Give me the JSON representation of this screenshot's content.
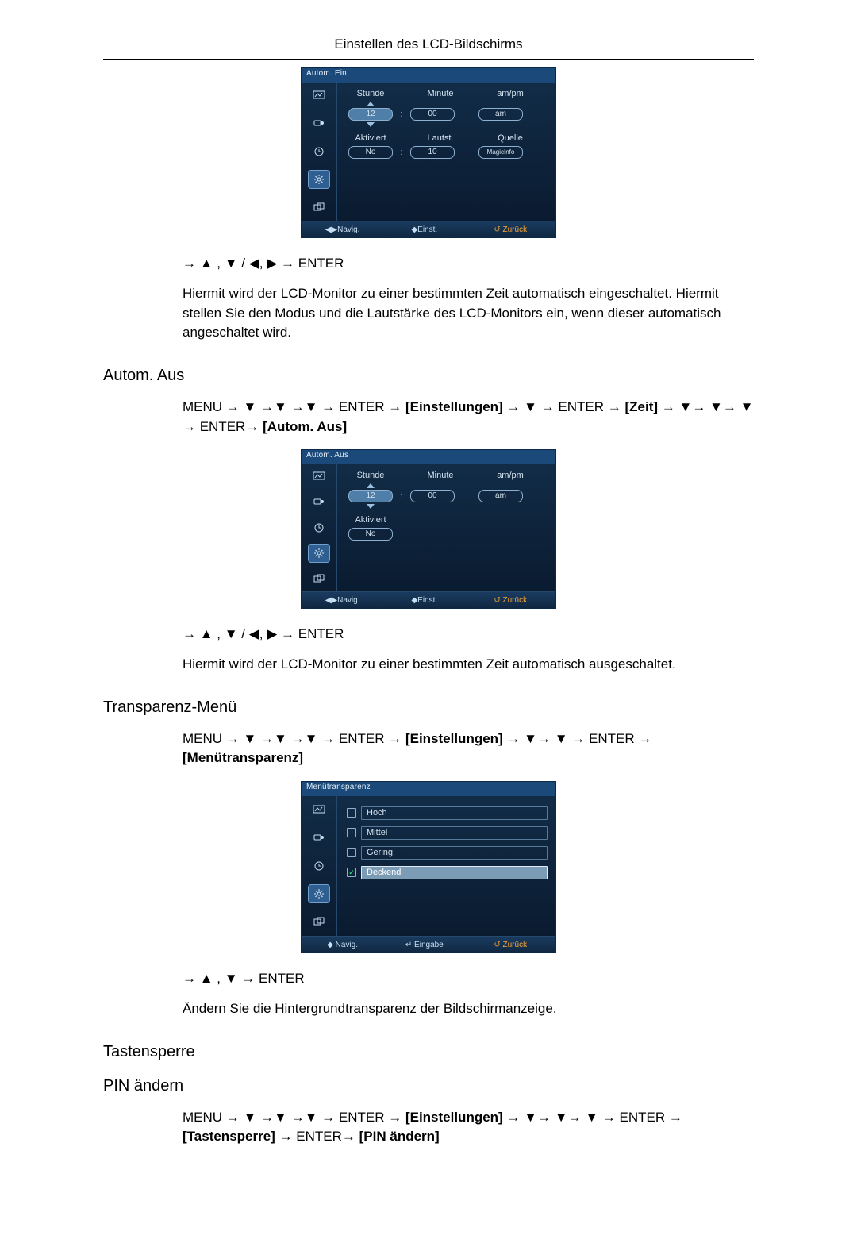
{
  "header": {
    "title": "Einstellen des LCD-Bildschirms"
  },
  "osd_on": {
    "title": "Autom. Ein",
    "labels": {
      "stunde": "Stunde",
      "minute": "Minute",
      "ampm": "am/pm",
      "aktiviert": "Aktiviert",
      "lautst": "Lautst.",
      "quelle": "Quelle"
    },
    "values": {
      "stunde": "12",
      "minute": "00",
      "ampm": "am",
      "aktiviert": "No",
      "lautst": "10",
      "quelle": "MagicInfo"
    },
    "footer": {
      "navig": "◀▶Navig.",
      "einst": "◆Einst.",
      "zurueck": "↺ Zurück"
    }
  },
  "nav_on_post": "→ ▲ , ▼ / ◀, ▶ → ENTER",
  "para_on": "Hiermit wird der LCD-Monitor zu einer bestimmten Zeit automatisch eingeschaltet. Hiermit stellen Sie den Modus und die Lautstärke des LCD-Monitors ein, wenn dieser automatisch angeschaltet wird.",
  "sec_off": {
    "heading": "Autom. Aus",
    "path_pre": "MENU → ▼ →▼ →▼ → ENTER → ",
    "path_b1": "[Einstellungen]",
    "path_mid1": " → ▼ → ENTER → ",
    "path_b2": "[Zeit]",
    "path_mid2": " → ▼→ ▼→ ▼ → ENTER→ ",
    "path_b3": "[Autom. Aus]"
  },
  "osd_off": {
    "title": "Autom. Aus",
    "labels": {
      "stunde": "Stunde",
      "minute": "Minute",
      "ampm": "am/pm",
      "aktiviert": "Aktiviert"
    },
    "values": {
      "stunde": "12",
      "minute": "00",
      "ampm": "am",
      "aktiviert": "No"
    },
    "footer": {
      "navig": "◀▶Navig.",
      "einst": "◆Einst.",
      "zurueck": "↺ Zurück"
    }
  },
  "nav_off_post": "→ ▲ , ▼ / ◀, ▶ → ENTER",
  "para_off": "Hiermit wird der LCD-Monitor zu einer bestimmten Zeit automatisch ausgeschaltet.",
  "sec_trans": {
    "heading": "Transparenz-Menü",
    "path_pre": "MENU → ▼ →▼ →▼ → ENTER → ",
    "path_b1": "[Einstellungen]",
    "path_mid1": " → ▼→ ▼ → ENTER → ",
    "path_b2": "[Menütransparenz]"
  },
  "osd_trans": {
    "title": "Menütransparenz",
    "options": {
      "hoch": "Hoch",
      "mittel": "Mittel",
      "gering": "Gering",
      "deckend": "Deckend"
    },
    "check": "✓",
    "footer": {
      "navig": "◆ Navig.",
      "eingabe": "↵ Eingabe",
      "zurueck": "↺ Zurück"
    }
  },
  "nav_trans_post": "→ ▲ , ▼ → ENTER",
  "para_trans": "Ändern Sie die Hintergrundtransparenz der Bildschirmanzeige.",
  "sec_lock": {
    "heading": "Tastensperre",
    "sub": "PIN ändern"
  },
  "pin_path": {
    "pre": "MENU → ▼ →▼ →▼ → ENTER → ",
    "b1": "[Einstellungen]",
    "mid1": " → ▼→ ▼→ ▼ → ENTER → ",
    "b2": "[Tastensperre]",
    "mid2": " → ENTER→ ",
    "b3": "[PIN ändern]"
  }
}
